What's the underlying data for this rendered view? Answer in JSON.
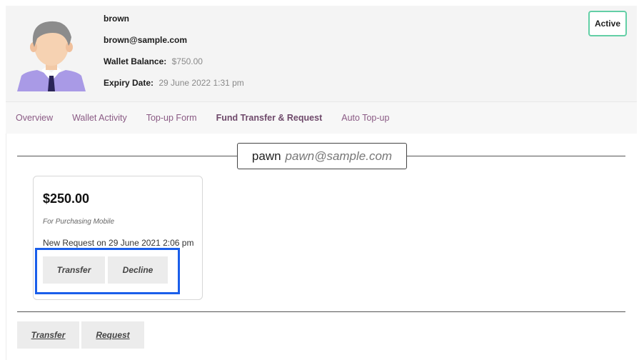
{
  "user": {
    "name": "brown",
    "email": "brown@sample.com",
    "wallet_label": "Wallet Balance:",
    "wallet_value": "$750.00",
    "expiry_label": "Expiry Date:",
    "expiry_value": "29 June 2022 1:31 pm",
    "status": "Active"
  },
  "tabs": [
    {
      "label": "Overview"
    },
    {
      "label": "Wallet Activity"
    },
    {
      "label": "Top-up Form"
    },
    {
      "label": "Fund Transfer & Request",
      "active": true
    },
    {
      "label": "Auto Top-up"
    }
  ],
  "contact": {
    "name": "pawn",
    "email": "pawn@sample.com"
  },
  "request": {
    "amount": "$250.00",
    "note": "For Purchasing Mobile",
    "date_text": "New Request on 29 June 2021 2:06 pm",
    "transfer_label": "Transfer",
    "decline_label": "Decline"
  },
  "actions": {
    "transfer_label": "Transfer",
    "request_label": "Request"
  },
  "colors": {
    "status_border": "#63cfa6",
    "tab_text": "#8a5a84",
    "highlight": "#1a5eea"
  }
}
